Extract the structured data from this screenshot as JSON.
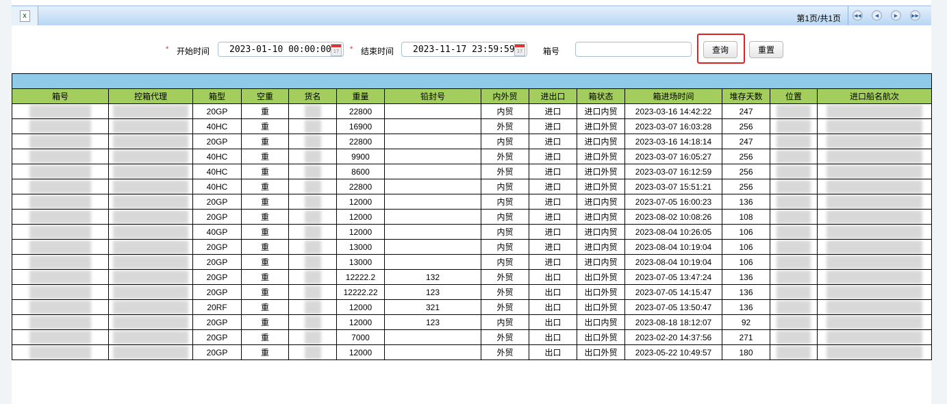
{
  "toolbar": {
    "export_icon": "excel-icon",
    "page_info": "第1页/共1页",
    "nav": [
      "first-page-icon",
      "prev-page-icon",
      "next-page-icon",
      "last-page-icon"
    ]
  },
  "form": {
    "start_label": "开始时间",
    "start_value": "2023-01-10 00:00:00",
    "end_label": "结束时间",
    "end_value": "2023-11-17 23:59:59",
    "box_label": "箱号",
    "box_value": "",
    "query": "查询",
    "reset": "重置",
    "required_mark": "*"
  },
  "columns": [
    "箱号",
    "控箱代理",
    "箱型",
    "空重",
    "货名",
    "重量",
    "铅封号",
    "内外贸",
    "进出口",
    "箱状态",
    "箱进场时间",
    "堆存天数",
    "位置",
    "进口船名航次"
  ],
  "rows": [
    [
      "",
      "",
      "20GP",
      "重",
      "",
      "22800",
      "",
      "内贸",
      "进口",
      "进口内贸",
      "2023-03-16  14:42:22",
      "247",
      "",
      ""
    ],
    [
      "",
      "",
      "40HC",
      "重",
      "",
      "16900",
      "",
      "外贸",
      "进口",
      "进口外贸",
      "2023-03-07  16:03:28",
      "256",
      "",
      ""
    ],
    [
      "",
      "",
      "20GP",
      "重",
      "",
      "22800",
      "",
      "内贸",
      "进口",
      "进口内贸",
      "2023-03-16  14:18:14",
      "247",
      "",
      ""
    ],
    [
      "",
      "",
      "40HC",
      "重",
      "",
      "9900",
      "",
      "外贸",
      "进口",
      "进口外贸",
      "2023-03-07  16:05:27",
      "256",
      "",
      ""
    ],
    [
      "",
      "",
      "40HC",
      "重",
      "",
      "8600",
      "",
      "外贸",
      "进口",
      "进口外贸",
      "2023-03-07  16:12:59",
      "256",
      "",
      ""
    ],
    [
      "",
      "",
      "40HC",
      "重",
      "",
      "22800",
      "",
      "内贸",
      "进口",
      "进口外贸",
      "2023-03-07  15:51:21",
      "256",
      "",
      ""
    ],
    [
      "",
      "",
      "20GP",
      "重",
      "",
      "12000",
      "",
      "内贸",
      "进口",
      "进口内贸",
      "2023-07-05  16:00:23",
      "136",
      "",
      ""
    ],
    [
      "",
      "",
      "20GP",
      "重",
      "",
      "12000",
      "",
      "内贸",
      "进口",
      "进口内贸",
      "2023-08-02  10:08:26",
      "108",
      "",
      ""
    ],
    [
      "",
      "",
      "40GP",
      "重",
      "",
      "12000",
      "",
      "内贸",
      "进口",
      "进口内贸",
      "2023-08-04  10:26:05",
      "106",
      "",
      ""
    ],
    [
      "",
      "",
      "20GP",
      "重",
      "",
      "13000",
      "",
      "内贸",
      "进口",
      "进口内贸",
      "2023-08-04  10:19:04",
      "106",
      "",
      ""
    ],
    [
      "",
      "",
      "20GP",
      "重",
      "",
      "13000",
      "",
      "内贸",
      "进口",
      "进口内贸",
      "2023-08-04  10:19:04",
      "106",
      "",
      ""
    ],
    [
      "",
      "",
      "20GP",
      "重",
      "",
      "12222.2",
      "132",
      "外贸",
      "出口",
      "出口外贸",
      "2023-07-05  13:47:24",
      "136",
      "",
      ""
    ],
    [
      "",
      "",
      "20GP",
      "重",
      "",
      "12222.22",
      "123",
      "外贸",
      "出口",
      "出口外贸",
      "2023-07-05  14:15:47",
      "136",
      "",
      ""
    ],
    [
      "",
      "",
      "20RF",
      "重",
      "",
      "12000",
      "321",
      "外贸",
      "出口",
      "出口外贸",
      "2023-07-05  13:50:47",
      "136",
      "",
      ""
    ],
    [
      "",
      "",
      "20GP",
      "重",
      "",
      "12000",
      "123",
      "内贸",
      "出口",
      "出口内贸",
      "2023-08-18  18:12:07",
      "92",
      "",
      ""
    ],
    [
      "",
      "",
      "20GP",
      "重",
      "",
      "7000",
      "",
      "外贸",
      "出口",
      "出口外贸",
      "2023-02-20  14:37:56",
      "271",
      "",
      ""
    ],
    [
      "",
      "",
      "20GP",
      "重",
      "",
      "12000",
      "",
      "外贸",
      "出口",
      "出口外贸",
      "2023-05-22  10:49:57",
      "180",
      "",
      ""
    ]
  ],
  "colors": {
    "header_bg": "#a3cd5d",
    "caption_bg": "#8fcbe8",
    "highlight": "#e02020"
  }
}
